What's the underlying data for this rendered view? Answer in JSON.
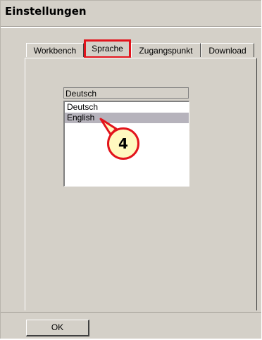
{
  "window": {
    "title": "Einstellungen"
  },
  "tabs": [
    {
      "label": "Workbench"
    },
    {
      "label": "Sprache",
      "active": true
    },
    {
      "label": "Zugangspunkt"
    },
    {
      "label": "Download"
    }
  ],
  "language": {
    "selected_value": "Deutsch",
    "options": [
      {
        "label": "Deutsch"
      },
      {
        "label": "English",
        "highlighted": true
      }
    ]
  },
  "callout": {
    "number": "4",
    "border_color": "#e2141c",
    "fill_color": "#fff9c0"
  },
  "footer": {
    "ok_label": "OK"
  },
  "colors": {
    "highlight": "#e2141c",
    "dialog_bg": "#d4d0c8",
    "selection_bg": "#b6b3bc"
  }
}
